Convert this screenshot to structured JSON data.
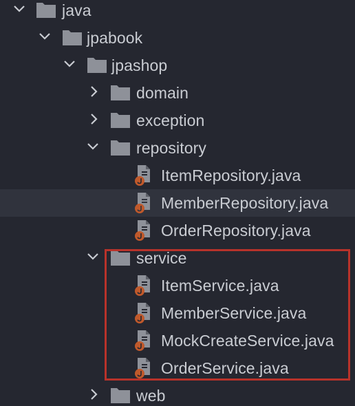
{
  "project_tree": {
    "nodes": [
      {
        "label": "java",
        "type": "folder",
        "expanded": true
      },
      {
        "label": "jpabook",
        "type": "folder",
        "expanded": true
      },
      {
        "label": "jpashop",
        "type": "folder",
        "expanded": true
      },
      {
        "label": "domain",
        "type": "folder",
        "expanded": false
      },
      {
        "label": "exception",
        "type": "folder",
        "expanded": false
      },
      {
        "label": "repository",
        "type": "folder",
        "expanded": true
      },
      {
        "label": "ItemRepository.java",
        "type": "java-file"
      },
      {
        "label": "MemberRepository.java",
        "type": "java-file",
        "selected": true
      },
      {
        "label": "OrderRepository.java",
        "type": "java-file"
      },
      {
        "label": "service",
        "type": "folder",
        "expanded": true
      },
      {
        "label": "ItemService.java",
        "type": "java-file"
      },
      {
        "label": "MemberService.java",
        "type": "java-file"
      },
      {
        "label": "MockCreateService.java",
        "type": "java-file"
      },
      {
        "label": "OrderService.java",
        "type": "java-file"
      },
      {
        "label": "web",
        "type": "folder",
        "expanded": false
      }
    ]
  },
  "icons": {
    "folder": "folder-icon",
    "java_file": "java-class-icon",
    "expanded": "chevron-down-icon",
    "collapsed": "chevron-right-icon"
  },
  "colors": {
    "background": "#252730",
    "selected_row": "#30333d",
    "text": "#c9ccd2",
    "folder": "#8e9199",
    "java_badge": "#c0592b",
    "highlight_border": "#b8322a"
  }
}
